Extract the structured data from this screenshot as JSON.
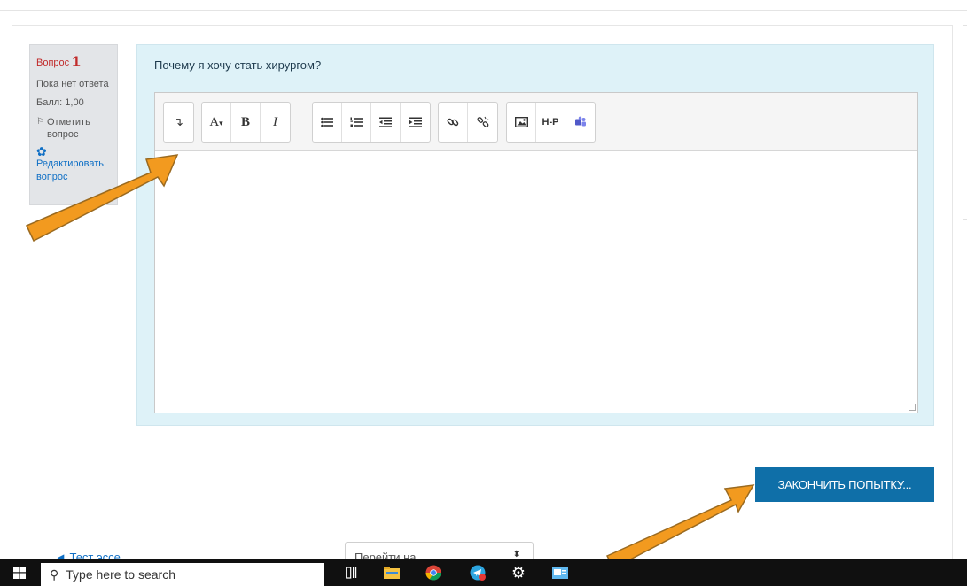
{
  "question_info": {
    "label": "Вопрос",
    "number": "1",
    "status": "Пока нет ответа",
    "score": "Балл: 1,00",
    "flag_label": "Отметить вопрос",
    "edit_label": "Редактировать вопрос"
  },
  "question": {
    "prompt": "Почему я хочу стать хирургом?",
    "answer_value": ""
  },
  "toolbar": {
    "groups": [
      [
        "collapse-icon"
      ],
      [
        "font-color-icon",
        "bold-icon",
        "italic-icon"
      ],
      [
        "unordered-list-icon",
        "ordered-list-icon",
        "outdent-icon",
        "indent-icon"
      ],
      [
        "link-icon",
        "unlink-icon"
      ],
      [
        "image-icon",
        "h5p-icon",
        "teams-icon"
      ]
    ],
    "font_label": "A",
    "bold_label": "B",
    "italic_label": "I",
    "h5p_label": "H-P"
  },
  "finish_button": {
    "label": "ЗАКОНЧИТЬ ПОПЫТКУ..."
  },
  "navigation": {
    "prev_link": "◄ Тест эссе",
    "jump_select": "Перейти на..."
  },
  "taskbar": {
    "search_placeholder": "Type here to search",
    "apps": [
      "task-view-icon",
      "file-explorer-icon",
      "chrome-icon",
      "telegram-icon",
      "settings-icon",
      "mail-icon"
    ]
  },
  "colors": {
    "accent": "#0f6fa8",
    "question_bg": "#def2f8",
    "info_bg": "#e3e5e8",
    "arrow": "#f29a1f",
    "taskbar": "#101010"
  }
}
